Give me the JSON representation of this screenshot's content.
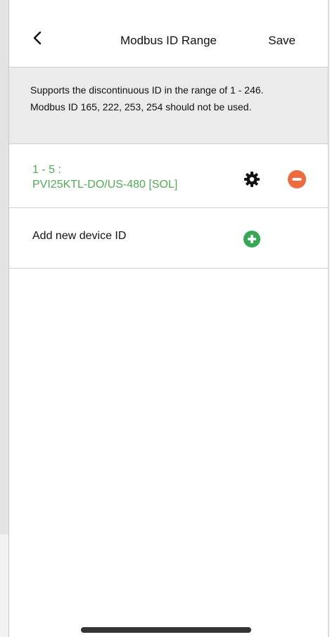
{
  "header": {
    "title": "Modbus ID Range",
    "save_label": "Save",
    "back_icon": "chevron-left-icon"
  },
  "info": {
    "line1": "Supports the discontinuous ID in the range of 1 - 246.",
    "line2": "Modbus ID 165, 222, 253, 254 should not be used."
  },
  "devices": [
    {
      "range": "1 - 5 :",
      "name": "PVI25KTL-DO/US-480 [SOL]",
      "settings_icon": "gear-icon",
      "remove_icon": "minus-circle-icon"
    }
  ],
  "add_device": {
    "label": "Add new device ID",
    "icon": "plus-circle-icon"
  },
  "colors": {
    "device_text": "#4caf50",
    "remove": "#f06a3c",
    "add": "#34a853",
    "banner_bg": "#ebebeb"
  }
}
